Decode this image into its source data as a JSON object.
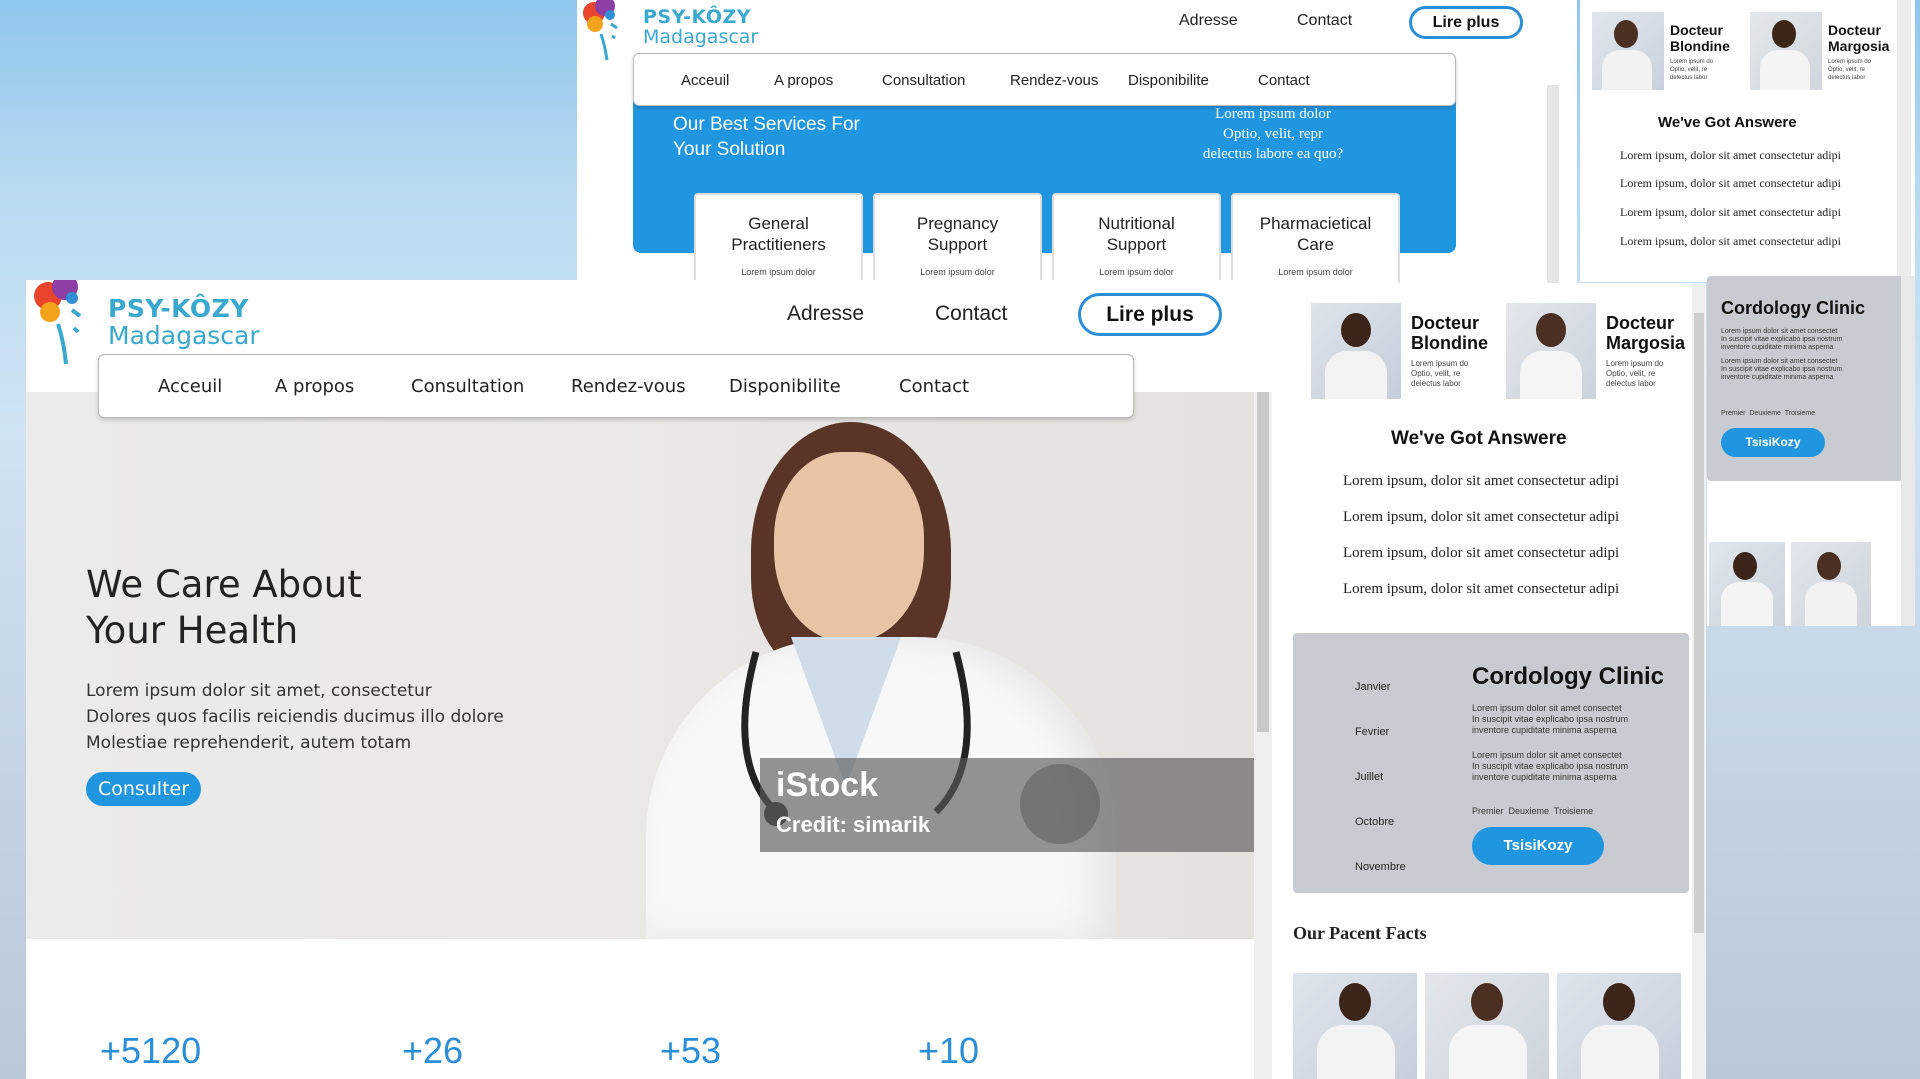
{
  "brand": {
    "name": "PSY-KÔZY",
    "country": "Madagascar"
  },
  "header": {
    "address": "Adresse",
    "contact": "Contact",
    "read_more": "Lire plus"
  },
  "nav": [
    "Acceuil",
    "A propos",
    "Consultation",
    "Rendez-vous",
    "Disponibilite",
    "Contact"
  ],
  "hero": {
    "title_line1": "We Care About",
    "title_line2": "Your Health",
    "text_line1": "Lorem ipsum dolor sit amet, consectetur",
    "text_line2": "Dolores quos facilis reiciendis ducimus illo dolore",
    "text_line3": "Molestiae reprehenderit, autem totam",
    "cta": "Consulter",
    "watermark": "iStock",
    "credit": "Credit: simarik"
  },
  "stats": [
    "+5120",
    "+26",
    "+53",
    "+10"
  ],
  "doctors": [
    {
      "title": "Docteur",
      "name": "Blondine",
      "desc_line1": "Lorem ipsum do",
      "desc_line2": "Optio, velit, re",
      "desc_line3": "delectus labor"
    },
    {
      "title": "Docteur",
      "name": "Margosia",
      "desc_line1": "Lorem ipsum do",
      "desc_line2": "Optio, velit, re",
      "desc_line3": "delectus labor"
    }
  ],
  "answers": {
    "title": "We've Got Answere",
    "items": [
      "Lorem ipsum, dolor sit amet consectetur adipi",
      "Lorem ipsum, dolor sit amet consectetur adipi",
      "Lorem ipsum, dolor sit amet consectetur adipi",
      "Lorem ipsum, dolor sit amet consectetur adipi"
    ]
  },
  "clinic": {
    "title": "Cordology Clinic",
    "months": [
      "Janvier",
      "Fevrier",
      "Juillet",
      "Octobre",
      "Novembre"
    ],
    "p1_line1": "Lorem ipsum dolor sit amet consectet",
    "p1_line2": "In suscipit vitae explicabo ipsa nostrum",
    "p1_line3": "inventore cupiditate minima asperna",
    "p2_line1": "Lorem ipsum dolor sit amet consectet",
    "p2_line2": "In suscipit vitae explicabo ipsa nostrum",
    "p2_line3": "inventore cupiditate minima asperna",
    "tabs": [
      "Premier",
      "Deuxieme",
      "Troisieme"
    ],
    "button": "TsisiKozy"
  },
  "facts_title": "Our Pacent Facts",
  "services": {
    "title_line1": "Our Best Services For",
    "title_line2": "Your Solution",
    "side_line1": "Lorem ipsum dolor",
    "side_line2": "Optio, velit, repr",
    "side_line3": "delectus labore ea quo?",
    "cards": [
      {
        "line1": "General",
        "line2": "Practitieners",
        "desc": "Lorem ipsum dolor"
      },
      {
        "line1": "Pregnancy",
        "line2": "Support",
        "desc": "Lorem ipsum dolor"
      },
      {
        "line1": "Nutritional",
        "line2": "Support",
        "desc": "Lorem ipsum dolor"
      },
      {
        "line1": "Pharmacietical",
        "line2": "Care",
        "desc": "Lorem ipsum dolor"
      }
    ]
  },
  "colors": {
    "accent": "#2196e0",
    "brand": "#3aa9cf",
    "clinic_bg": "#c8ccd2"
  }
}
